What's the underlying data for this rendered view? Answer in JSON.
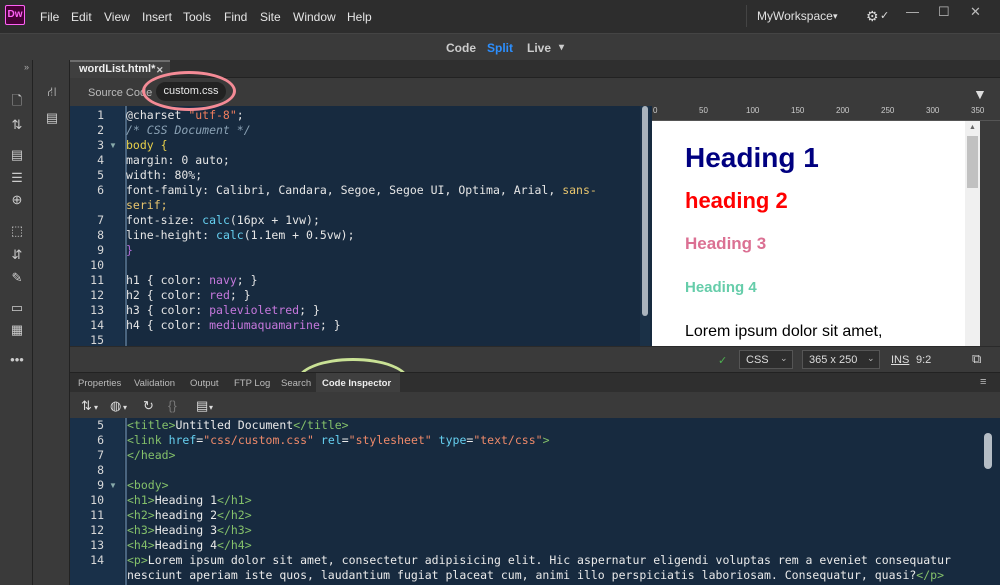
{
  "app": {
    "logo": "Dw"
  },
  "menu": [
    "File",
    "Edit",
    "View",
    "Insert",
    "Tools",
    "Find",
    "Site",
    "Window",
    "Help"
  ],
  "workspace": {
    "label": "MyWorkspace",
    "caret": "▾"
  },
  "window_buttons": {
    "minimize": "—",
    "maximize": "☐",
    "close": "✕"
  },
  "view_modes": {
    "code": "Code",
    "split": "Split",
    "live": "Live",
    "caret": "▾",
    "active": "Split"
  },
  "document_tab": {
    "name": "wordList.html*",
    "close": "✕"
  },
  "related_files": {
    "source": "Source Code",
    "css": "custom.css"
  },
  "editor": {
    "line_numbers": [
      "1",
      "2",
      "3",
      "4",
      "5",
      "6",
      "",
      "7",
      "8",
      "9",
      "10",
      "11",
      "12",
      "13",
      "14",
      "15"
    ],
    "lines": [
      "@charset \"utf-8\";",
      "/* CSS Document */",
      "body {",
      "margin: 0 auto;",
      "width: 80%;",
      "font-family: Calibri, Candara, Segoe, Segoe UI, Optima, Arial, sans-",
      "serif;",
      "font-size: calc(16px + 1vw);",
      "line-height: calc(1.1em + 0.5vw);",
      "}",
      "",
      "h1 { color: navy; }",
      "h2 { color: red; }",
      "h3 { color: palevioletred; }",
      "h4 { color: mediumaquamarine; }",
      ""
    ]
  },
  "ruler": [
    "0",
    "50",
    "100",
    "150",
    "200",
    "250",
    "300",
    "350"
  ],
  "live_view": {
    "h1": "Heading 1",
    "h2": "heading 2",
    "h3": "Heading 3",
    "h4": "Heading 4",
    "p": "Lorem ipsum dolor sit amet,"
  },
  "status_bar": {
    "check": "✓",
    "language": "CSS",
    "size": "365 x 250",
    "mode": "INS",
    "position": "9:2"
  },
  "panel_tabs": [
    "Properties",
    "Validation",
    "Output",
    "FTP Log",
    "Search",
    "Code Inspector"
  ],
  "panel_active": "Code Inspector",
  "inspector": {
    "line_numbers": [
      "5",
      "6",
      "7",
      "8",
      "9",
      "10",
      "11",
      "12",
      "13",
      "14",
      ""
    ],
    "lines": [
      "<title>Untitled Document</title>",
      "<link href=\"css/custom.css\" rel=\"stylesheet\" type=\"text/css\">",
      "</head>",
      "",
      "<body>",
      "<h1>Heading 1</h1>",
      "<h2>heading 2</h2>",
      "<h3>Heading 3</h3>",
      "<h4>Heading 4</h4>",
      "<p>Lorem ipsum dolor sit amet, consectetur adipisicing elit. Hic aspernatur eligendi voluptas rem a eveniet consequatur",
      "nesciunt aperiam iste quos, laudantium fugiat placeat cum, animi illo perspiciatis laboriosam. Consequatur, quasi?</p>"
    ]
  },
  "colors": {
    "accent": "#2c8fff",
    "editor_bg": "#172a3f",
    "annotation_pink": "#f48b96",
    "annotation_green": "#c9e195"
  }
}
